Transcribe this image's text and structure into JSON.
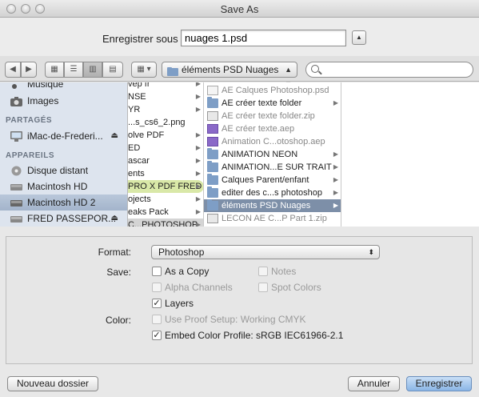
{
  "window": {
    "title": "Save As"
  },
  "save": {
    "label": "Enregistrer sous :",
    "filename": "nuages 1.psd"
  },
  "toolbar": {
    "path": "éléments PSD Nuages",
    "search_placeholder": ""
  },
  "sidebar": {
    "top_items": [
      {
        "label": "Musique"
      },
      {
        "label": "Images"
      }
    ],
    "shared_header": "PARTAGÉS",
    "shared": [
      {
        "label": "iMac-de-Frederi..."
      }
    ],
    "devices_header": "APPAREILS",
    "devices": [
      {
        "label": "Disque distant"
      },
      {
        "label": "Macintosh HD"
      },
      {
        "label": "Macintosh HD 2"
      },
      {
        "label": "FRED PASSEPOR..."
      }
    ]
  },
  "column2": [
    {
      "label": "vep fr"
    },
    {
      "label": "NSE"
    },
    {
      "label": "YR"
    },
    {
      "label": "...s_cs6_2.png"
    },
    {
      "label": "olve PDF"
    },
    {
      "label": "ED"
    },
    {
      "label": "ascar"
    },
    {
      "label": "ents"
    },
    {
      "label": "PRO X PDF FRED"
    },
    {
      "label": "ojects"
    },
    {
      "label": "eaks Pack"
    },
    {
      "label": "C...PHOTOSHOP"
    }
  ],
  "column3": [
    {
      "label": "AE Calques Photoshop.psd"
    },
    {
      "label": "AE créer texte folder"
    },
    {
      "label": "AE créer texte folder.zip"
    },
    {
      "label": "AE créer texte.aep"
    },
    {
      "label": "Animation C...otoshop.aep"
    },
    {
      "label": "ANIMATION NEON"
    },
    {
      "label": "ANIMATION...E SUR TRAIT"
    },
    {
      "label": "Calques Parent/enfant"
    },
    {
      "label": "editer des c...s photoshop"
    },
    {
      "label": "éléments PSD Nuages"
    },
    {
      "label": "LECON AE C...P Part 1.zip"
    }
  ],
  "options": {
    "format_label": "Format:",
    "format_value": "Photoshop",
    "save_label": "Save:",
    "as_copy": "As a Copy",
    "notes": "Notes",
    "alpha_channels": "Alpha Channels",
    "spot_colors": "Spot Colors",
    "layers": "Layers",
    "color_label": "Color:",
    "proof_setup": "Use Proof Setup:  Working CMYK",
    "embed_profile": "Embed Color Profile:  sRGB IEC61966-2.1"
  },
  "buttons": {
    "new_folder": "Nouveau dossier",
    "cancel": "Annuler",
    "save": "Enregistrer"
  }
}
